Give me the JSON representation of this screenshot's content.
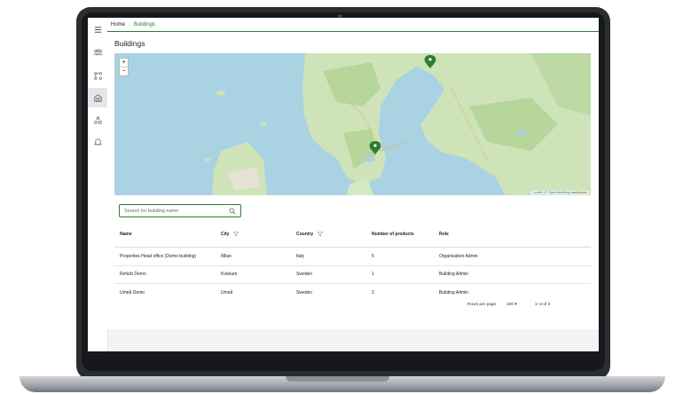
{
  "breadcrumb": {
    "home": "Home",
    "separator": "›",
    "current": "Buildings"
  },
  "page_title": "Buildings",
  "map": {
    "zoom_in": "+",
    "zoom_out": "−",
    "attribution_leaflet": "Leaflet",
    "attribution_sep": " | © ",
    "attribution_osm": "OpenStreetMap",
    "attribution_tail": " contributors",
    "pin_color": "#2e7d32"
  },
  "search": {
    "placeholder": "Search for building name",
    "value": ""
  },
  "table": {
    "headers": [
      "Name",
      "City",
      "Country",
      "Number of products",
      "Role"
    ],
    "rows": [
      [
        "Properties Head office (Demo building)",
        "Milan",
        "Italy",
        "5",
        "Organisation Admin"
      ],
      [
        "Refurb Demo",
        "Kvänum",
        "Sweden",
        "1",
        "Building Admin"
      ],
      [
        "Umeå Demo",
        "Umeå",
        "Sweden",
        "2",
        "Building Admin"
      ]
    ]
  },
  "pagination": {
    "rows_per_page_label": "Rows per page:",
    "rows_per_page_value": "100",
    "range": "1–3 of 3"
  },
  "sidebar": {
    "icons": [
      "menu-icon",
      "users-icon",
      "hierarchy-icon",
      "building-icon",
      "shapes-icon",
      "bell-icon"
    ]
  },
  "colors": {
    "accent": "#2e7d32",
    "map_water": "#a9d2e3",
    "map_land": "#cfe3b8"
  }
}
